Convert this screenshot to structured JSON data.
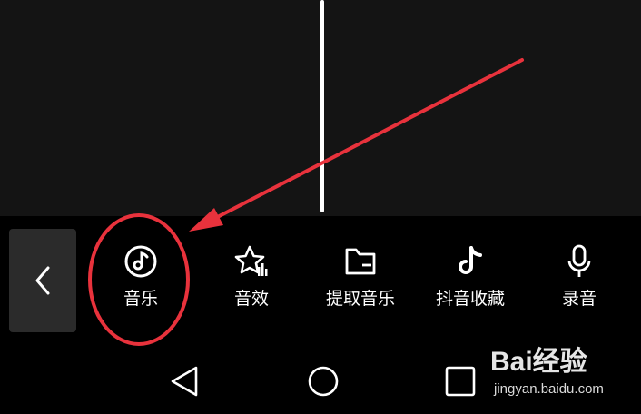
{
  "toolbar": {
    "tools": [
      {
        "label": "音乐",
        "icon": "music-note-icon"
      },
      {
        "label": "音效",
        "icon": "sound-effect-star-icon"
      },
      {
        "label": "提取音乐",
        "icon": "folder-icon"
      },
      {
        "label": "抖音收藏",
        "icon": "douyin-logo-icon"
      },
      {
        "label": "录音",
        "icon": "microphone-icon"
      }
    ],
    "back_icon": "chevron-left-icon"
  },
  "navbar": {
    "icons": [
      "back-triangle-icon",
      "home-circle-icon",
      "recents-square-icon"
    ]
  },
  "watermark": {
    "text": "Bai经验",
    "url": "jingyan.baidu.com"
  },
  "colors": {
    "timeline_bg": "#141414",
    "toolbar_bg": "#000000",
    "annotation_red": "#e8323c",
    "back_button_bg": "#2b2b2b"
  }
}
